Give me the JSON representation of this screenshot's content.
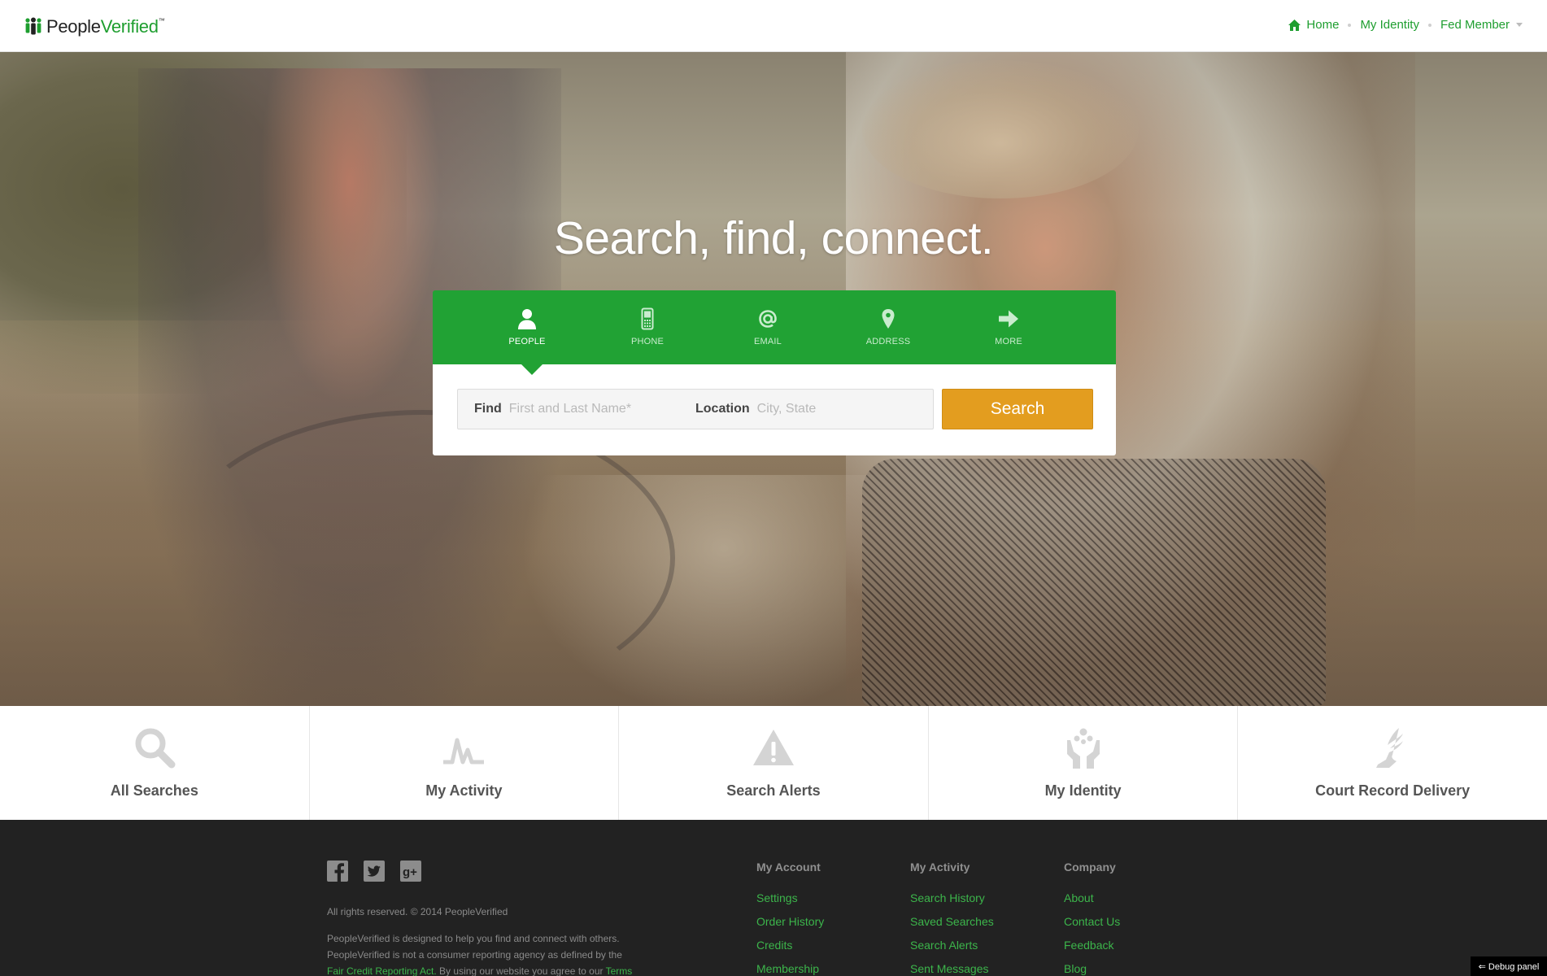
{
  "header": {
    "logo": {
      "word1": "People",
      "word2": "Verified",
      "tm": "™"
    },
    "nav": [
      {
        "label": "Home",
        "icon": "home-icon"
      },
      {
        "label": "My Identity"
      },
      {
        "label": "Fed Member",
        "icon": "chevron-down-icon"
      }
    ]
  },
  "hero": {
    "headline": "Search, find, connect."
  },
  "search": {
    "tabs": [
      {
        "label": "PEOPLE",
        "icon": "person-icon",
        "active": true
      },
      {
        "label": "PHONE",
        "icon": "phone-icon",
        "active": false
      },
      {
        "label": "EMAIL",
        "icon": "at-icon",
        "active": false
      },
      {
        "label": "ADDRESS",
        "icon": "map-pin-icon",
        "active": false
      },
      {
        "label": "MORE",
        "icon": "arrow-right-icon",
        "active": false
      }
    ],
    "find_label": "Find",
    "find_placeholder": "First and Last Name*",
    "location_label": "Location",
    "location_placeholder": "City, State",
    "button_label": "Search"
  },
  "tiles": [
    {
      "label": "All Searches",
      "icon": "magnifier-icon"
    },
    {
      "label": "My Activity",
      "icon": "activity-icon"
    },
    {
      "label": "Search Alerts",
      "icon": "warning-icon"
    },
    {
      "label": "My Identity",
      "icon": "identity-hands-icon"
    },
    {
      "label": "Court Record Delivery",
      "icon": "winged-foot-icon"
    }
  ],
  "footer": {
    "social": [
      "facebook-icon",
      "twitter-icon",
      "google-plus-icon"
    ],
    "copyright": "All rights reserved. © 2014 PeopleVerified",
    "disclaimer_line1": "PeopleVerified is designed to help you find and connect with others.",
    "disclaimer_line2": "PeopleVerified is not a consumer reporting agency as defined by the",
    "disclaimer_link": "Fair Credit Reporting Act.",
    "disclaimer_line3": " By using our website you agree to our ",
    "disclaimer_terms": "Terms",
    "columns": [
      {
        "title": "My Account",
        "links": [
          "Settings",
          "Order History",
          "Credits",
          "Membership"
        ]
      },
      {
        "title": "My Activity",
        "links": [
          "Search History",
          "Saved Searches",
          "Search Alerts",
          "Sent Messages"
        ]
      },
      {
        "title": "Company",
        "links": [
          "About",
          "Contact Us",
          "Feedback",
          "Blog"
        ]
      }
    ]
  },
  "debug_label": "⇐ Debug panel",
  "colors": {
    "brand_green": "#21a234",
    "link_green": "#3cb54b",
    "search_orange": "#e39d1f",
    "footer_bg": "#222222"
  }
}
